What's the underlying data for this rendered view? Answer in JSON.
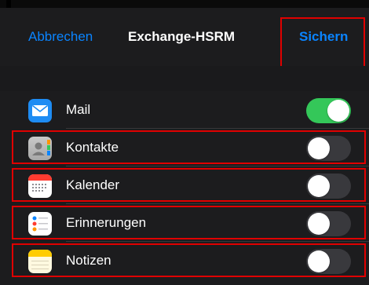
{
  "navbar": {
    "cancel_label": "Abbrechen",
    "title": "Exchange-HSRM",
    "save_label": "Sichern"
  },
  "colors": {
    "accent": "#0a84ff",
    "toggle_on": "#34c759",
    "toggle_off": "#39393d",
    "highlight": "#e00000"
  },
  "items": [
    {
      "label": "Mail",
      "icon": "mail-icon",
      "enabled": true
    },
    {
      "label": "Kontakte",
      "icon": "contacts-icon",
      "enabled": false
    },
    {
      "label": "Kalender",
      "icon": "calendar-icon",
      "enabled": false
    },
    {
      "label": "Erinnerungen",
      "icon": "reminders-icon",
      "enabled": false
    },
    {
      "label": "Notizen",
      "icon": "notes-icon",
      "enabled": false
    }
  ]
}
